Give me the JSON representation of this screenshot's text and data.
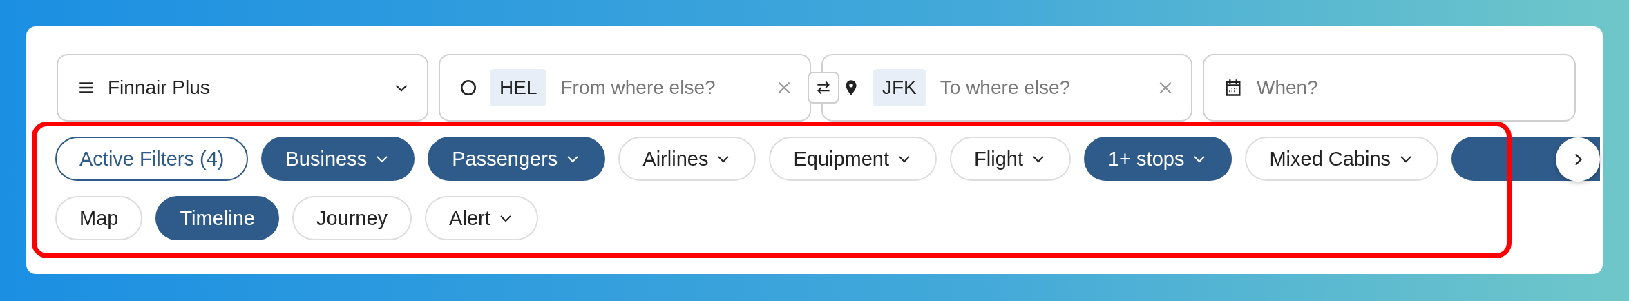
{
  "program_select": {
    "value": "Finnair Plus"
  },
  "origin": {
    "code": "HEL",
    "placeholder": "From where else?"
  },
  "destination": {
    "code": "JFK",
    "placeholder": "To where else?"
  },
  "date": {
    "placeholder": "When?"
  },
  "filters": {
    "highlighted": true,
    "rows": [
      {
        "chips": [
          {
            "label": "Active Filters (4)",
            "kind": "summary",
            "selected": false,
            "menu": false
          },
          {
            "label": "Business",
            "kind": "chip",
            "selected": true,
            "menu": true
          },
          {
            "label": "Passengers",
            "kind": "chip",
            "selected": true,
            "menu": true
          },
          {
            "label": "Airlines",
            "kind": "chip",
            "selected": false,
            "menu": true
          },
          {
            "label": "Equipment",
            "kind": "chip",
            "selected": false,
            "menu": true
          },
          {
            "label": "Flight",
            "kind": "chip",
            "selected": false,
            "menu": true
          },
          {
            "label": "1+ stops",
            "kind": "chip",
            "selected": true,
            "menu": true
          },
          {
            "label": "Mixed Cabins",
            "kind": "chip",
            "selected": false,
            "menu": true
          }
        ]
      },
      {
        "chips": [
          {
            "label": "Map",
            "kind": "chip",
            "selected": false,
            "menu": false
          },
          {
            "label": "Timeline",
            "kind": "chip",
            "selected": true,
            "menu": false
          },
          {
            "label": "Journey",
            "kind": "chip",
            "selected": false,
            "menu": false
          },
          {
            "label": "Alert",
            "kind": "chip",
            "selected": false,
            "menu": true
          }
        ]
      }
    ]
  }
}
